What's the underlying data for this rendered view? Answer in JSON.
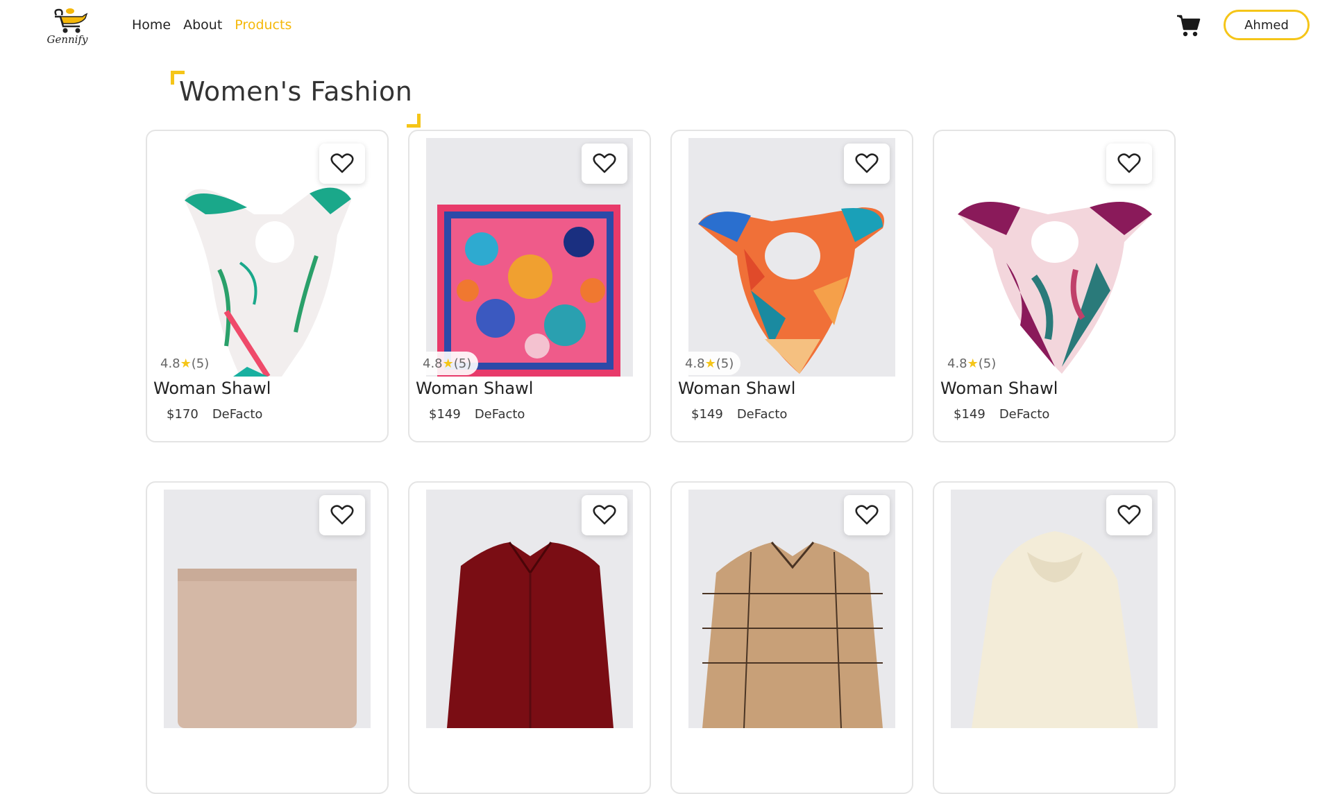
{
  "brand": {
    "name": "Gennify",
    "logo_icon": "genie-lamp-cart-icon",
    "accent": "#f5b80a"
  },
  "nav": {
    "links": [
      {
        "label": "Home",
        "active": false
      },
      {
        "label": "About",
        "active": false
      },
      {
        "label": "Products",
        "active": true
      }
    ],
    "cart_icon": "shopping-cart-icon",
    "user_name": "Ahmed"
  },
  "section": {
    "title": "Women's Fashion"
  },
  "products": [
    {
      "name": "Woman Shawl",
      "price": "$170",
      "brand": "DeFacto",
      "rating": "4.8",
      "reviews": "(5)",
      "image": "white-green-floral-shawl"
    },
    {
      "name": "Woman Shawl",
      "price": "$149",
      "brand": "DeFacto",
      "rating": "4.8",
      "reviews": "(5)",
      "image": "pink-blue-floral-square-shawl"
    },
    {
      "name": "Woman Shawl",
      "price": "$149",
      "brand": "DeFacto",
      "rating": "4.8",
      "reviews": "(5)",
      "image": "orange-teal-pattern-shawl"
    },
    {
      "name": "Woman Shawl",
      "price": "$149",
      "brand": "DeFacto",
      "rating": "4.8",
      "reviews": "(5)",
      "image": "magenta-leaf-shawl"
    },
    {
      "name": "",
      "price": "",
      "brand": "",
      "rating": "",
      "reviews": "",
      "image": "beige-folded-item"
    },
    {
      "name": "",
      "price": "",
      "brand": "",
      "rating": "",
      "reviews": "",
      "image": "burgundy-shirt"
    },
    {
      "name": "",
      "price": "",
      "brand": "",
      "rating": "",
      "reviews": "",
      "image": "brown-plaid-shirt"
    },
    {
      "name": "",
      "price": "",
      "brand": "",
      "rating": "",
      "reviews": "",
      "image": "cream-hoodie"
    }
  ],
  "icons": {
    "favorite": "heart-outline-icon",
    "rating": "star-icon"
  },
  "colors": {
    "accent_yellow": "#f5c518",
    "card_border": "#e4e4e4"
  }
}
